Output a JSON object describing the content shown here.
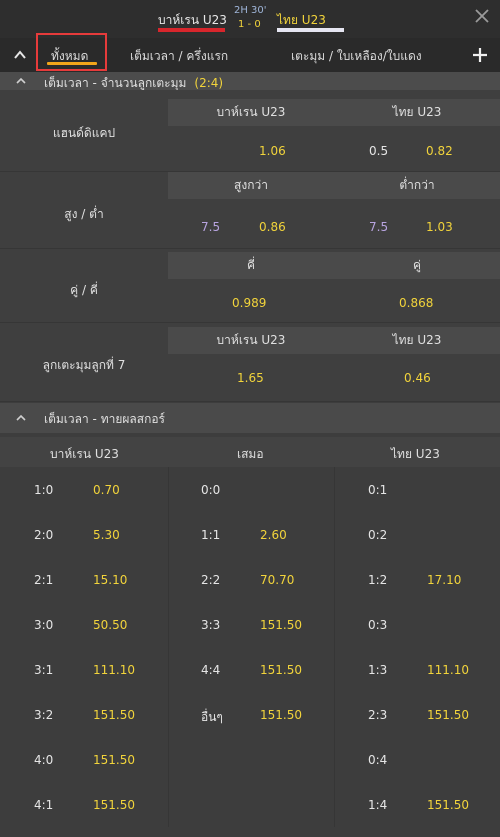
{
  "header": {
    "home_team": "บาห์เรน U23",
    "away_team": "ไทย U23",
    "time": "2H 30'",
    "score": "1 - 0"
  },
  "tabs": {
    "all": "ทั้งหมด",
    "full_half": "เต็มเวลา / ครึ่งแรก",
    "corners_cards": "เตะมุม / ใบเหลือง/ใบแดง"
  },
  "corners_section": {
    "title": "เต็มเวลา - จำนวนลูกเตะมุม",
    "count": "(2:4)",
    "handicap": {
      "label": "แฮนด์ดิแคป",
      "home": "บาห์เรน U23",
      "away": "ไทย U23",
      "home_odd": "1.06",
      "away_line": "0.5",
      "away_odd": "0.82"
    },
    "over_under": {
      "label": "สูง / ต่ำ",
      "over": "สูงกว่า",
      "under": "ต่ำกว่า",
      "over_line": "7.5",
      "over_odd": "0.86",
      "under_line": "7.5",
      "under_odd": "1.03"
    },
    "odd_even": {
      "label": "คู่ / คี่",
      "odd": "คี่",
      "even": "คู่",
      "odd_odd": "0.989",
      "even_odd": "0.868"
    },
    "seventh_corner": {
      "label": "ลูกเตะมุมลูกที่ 7",
      "home": "บาห์เรน U23",
      "away": "ไทย U23",
      "home_odd": "1.65",
      "away_odd": "0.46"
    }
  },
  "correct_score": {
    "title": "เต็มเวลา - ทายผลสกอร์",
    "col_home": "บาห์เรน U23",
    "col_draw": "เสมอ",
    "col_away": "ไทย U23",
    "rows": [
      {
        "h": "1:0",
        "ho": "0.70",
        "d": "0:0",
        "do": "",
        "a": "0:1",
        "ao": ""
      },
      {
        "h": "2:0",
        "ho": "5.30",
        "d": "1:1",
        "do": "2.60",
        "a": "0:2",
        "ao": ""
      },
      {
        "h": "2:1",
        "ho": "15.10",
        "d": "2:2",
        "do": "70.70",
        "a": "1:2",
        "ao": "17.10"
      },
      {
        "h": "3:0",
        "ho": "50.50",
        "d": "3:3",
        "do": "151.50",
        "a": "0:3",
        "ao": ""
      },
      {
        "h": "3:1",
        "ho": "111.10",
        "d": "4:4",
        "do": "151.50",
        "a": "1:3",
        "ao": "111.10"
      },
      {
        "h": "3:2",
        "ho": "151.50",
        "d": "อื่นๆ",
        "do": "151.50",
        "a": "2:3",
        "ao": "151.50"
      },
      {
        "h": "4:0",
        "ho": "151.50",
        "d": "",
        "do": "",
        "a": "0:4",
        "ao": ""
      },
      {
        "h": "4:1",
        "ho": "151.50",
        "d": "",
        "do": "",
        "a": "1:4",
        "ao": "151.50"
      }
    ]
  }
}
